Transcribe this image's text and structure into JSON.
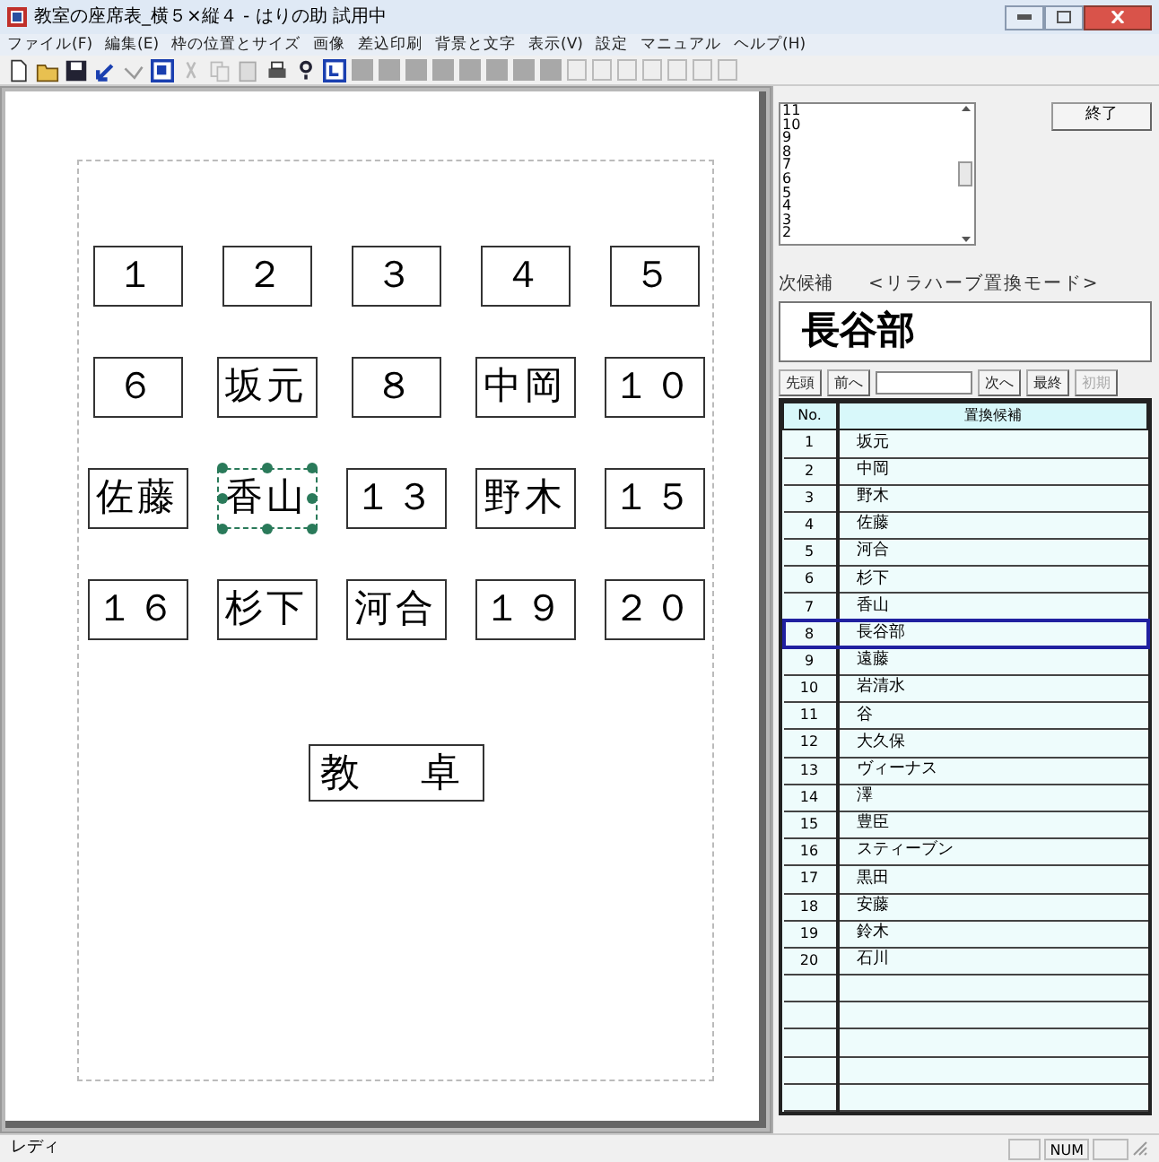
{
  "window": {
    "title": "教室の座席表_横５×縦４ - はりの助 試用中"
  },
  "menu": [
    "ファイル(F)",
    "編集(E)",
    "枠の位置とサイズ",
    "画像",
    "差込印刷",
    "背景と文字",
    "表示(V)",
    "設定",
    "マニュアル",
    "ヘルプ(H)"
  ],
  "seats": [
    [
      {
        "text": "１",
        "selected": false
      },
      {
        "text": "２",
        "selected": false
      },
      {
        "text": "３",
        "selected": false
      },
      {
        "text": "４",
        "selected": false
      },
      {
        "text": "５",
        "selected": false
      }
    ],
    [
      {
        "text": "６",
        "selected": false
      },
      {
        "text": "坂元",
        "selected": false
      },
      {
        "text": "８",
        "selected": false
      },
      {
        "text": "中岡",
        "selected": false
      },
      {
        "text": "１０",
        "selected": false
      }
    ],
    [
      {
        "text": "佐藤",
        "selected": false
      },
      {
        "text": "香山",
        "selected": true
      },
      {
        "text": "１３",
        "selected": false
      },
      {
        "text": "野木",
        "selected": false
      },
      {
        "text": "１５",
        "selected": false
      }
    ],
    [
      {
        "text": "１６",
        "selected": false
      },
      {
        "text": "杉下",
        "selected": false
      },
      {
        "text": "河合",
        "selected": false
      },
      {
        "text": "１９",
        "selected": false
      },
      {
        "text": "２０",
        "selected": false
      }
    ]
  ],
  "teacher_desk": "教　卓",
  "history_list": [
    "11",
    "10",
    "9",
    "8",
    "7",
    "6",
    "5",
    "4",
    "3",
    "2"
  ],
  "close_button": "終了",
  "next_label": "次候補",
  "mode_label": "<リラハーブ置換モード>",
  "next_candidate": "長谷部",
  "nav_buttons": [
    {
      "label": "先頭",
      "disabled": false
    },
    {
      "label": "前へ",
      "disabled": false
    },
    {
      "label": "次へ",
      "disabled": false
    },
    {
      "label": "最終",
      "disabled": false
    },
    {
      "label": "初期",
      "disabled": true
    }
  ],
  "table": {
    "columns": [
      "No.",
      "置換候補"
    ],
    "rows": [
      {
        "no": "1",
        "name": "坂元",
        "selected": false
      },
      {
        "no": "2",
        "name": "中岡",
        "selected": false
      },
      {
        "no": "3",
        "name": "野木",
        "selected": false
      },
      {
        "no": "4",
        "name": "佐藤",
        "selected": false
      },
      {
        "no": "5",
        "name": "河合",
        "selected": false
      },
      {
        "no": "6",
        "name": "杉下",
        "selected": false
      },
      {
        "no": "7",
        "name": "香山",
        "selected": false
      },
      {
        "no": "8",
        "name": "長谷部",
        "selected": true
      },
      {
        "no": "9",
        "name": "遠藤",
        "selected": false
      },
      {
        "no": "10",
        "name": "岩清水",
        "selected": false
      },
      {
        "no": "11",
        "name": "谷",
        "selected": false
      },
      {
        "no": "12",
        "name": "大久保",
        "selected": false
      },
      {
        "no": "13",
        "name": "ヴィーナス",
        "selected": false
      },
      {
        "no": "14",
        "name": "澤",
        "selected": false
      },
      {
        "no": "15",
        "name": "豊臣",
        "selected": false
      },
      {
        "no": "16",
        "name": "スティーブン",
        "selected": false
      },
      {
        "no": "17",
        "name": "黒田",
        "selected": false
      },
      {
        "no": "18",
        "name": "安藤",
        "selected": false
      },
      {
        "no": "19",
        "name": "鈴木",
        "selected": false
      },
      {
        "no": "20",
        "name": "石川",
        "selected": false
      }
    ]
  },
  "status_bar": {
    "text": "レディ",
    "num": "NUM"
  }
}
